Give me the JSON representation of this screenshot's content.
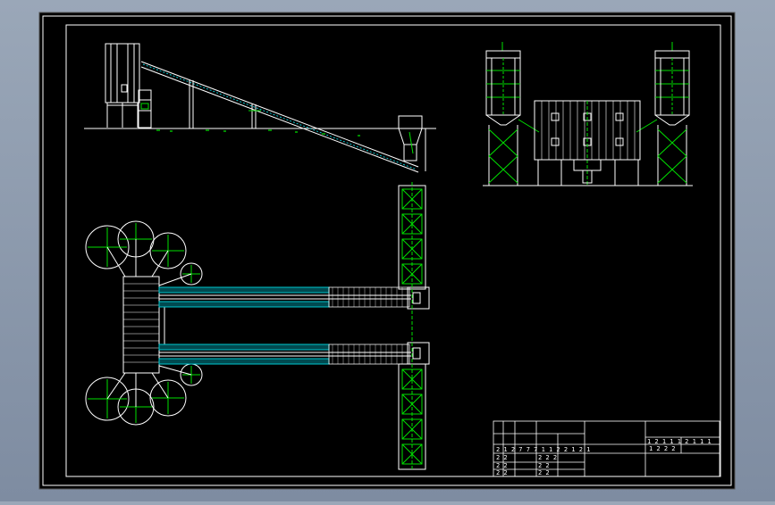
{
  "colors": {
    "viewport_bg": "#8f9cb0",
    "paper": "#000000",
    "line": "#ffffff",
    "accent": "#00e000",
    "conveyor": "#00c8d0"
  },
  "title_block": {
    "row1_left": "2 1 2   7 7 7 1 1   2   2 1 2   1",
    "row1_right": "1 2 1 1   1 2 1 1   1",
    "row2_left": "2   2",
    "row2_mid": "2 2 2",
    "row2_right": "1   2   2   2",
    "row3_left": "2   2",
    "row3_mid": "2   2",
    "row4_left": "2   2",
    "row4_mid": "2   2"
  }
}
